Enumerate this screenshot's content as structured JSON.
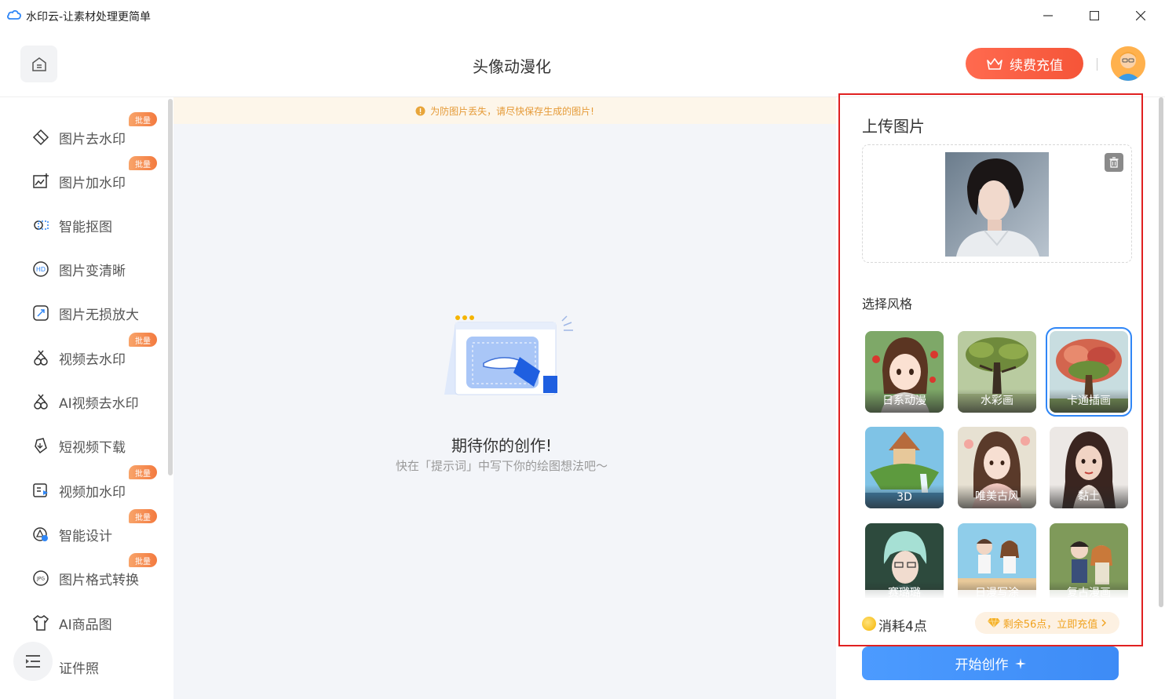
{
  "window": {
    "title": "水印云-让素材处理更简单"
  },
  "header": {
    "page_title": "头像动漫化",
    "renew_label": "续费充值"
  },
  "sidebar": {
    "batch_badge": "批量",
    "items": [
      {
        "label": "图片去水印",
        "icon": "eraser-icon",
        "batch": true
      },
      {
        "label": "图片加水印",
        "icon": "image-add-icon",
        "batch": true
      },
      {
        "label": "智能抠图",
        "icon": "cutout-icon",
        "batch": false
      },
      {
        "label": "图片变清晰",
        "icon": "hd-icon",
        "batch": false
      },
      {
        "label": "图片无损放大",
        "icon": "enlarge-icon",
        "batch": false
      },
      {
        "label": "视频去水印",
        "icon": "video-clean-icon",
        "batch": true
      },
      {
        "label": "AI视频去水印",
        "icon": "ai-video-icon",
        "batch": false
      },
      {
        "label": "短视频下载",
        "icon": "download-icon",
        "batch": false
      },
      {
        "label": "视频加水印",
        "icon": "video-add-icon",
        "batch": true
      },
      {
        "label": "智能设计",
        "icon": "design-icon",
        "batch": true
      },
      {
        "label": "图片格式转换",
        "icon": "jpg-convert-icon",
        "batch": true
      },
      {
        "label": "AI商品图",
        "icon": "tshirt-icon",
        "batch": false
      },
      {
        "label": "证件照",
        "icon": "id-photo-icon",
        "batch": false
      }
    ]
  },
  "main": {
    "notice": "为防图片丢失，请尽快保存生成的图片!",
    "empty_title": "期待你的创作!",
    "empty_subtitle": "快在「提示词」中写下你的绘图想法吧～"
  },
  "panel": {
    "upload_title": "上传图片",
    "style_title": "选择风格",
    "styles": [
      {
        "label": "日系动漫",
        "selected": false
      },
      {
        "label": "水彩画",
        "selected": false
      },
      {
        "label": "卡通插画",
        "selected": true
      },
      {
        "label": "3D",
        "selected": false
      },
      {
        "label": "唯美古风",
        "selected": false
      },
      {
        "label": "黏土",
        "selected": false
      },
      {
        "label": "赛璐璐",
        "selected": false
      },
      {
        "label": "日漫写涂",
        "selected": false
      },
      {
        "label": "复古漫画",
        "selected": false
      }
    ],
    "cost_text": "消耗4点",
    "remaining_text": "剩余56点，立即充值",
    "create_label": "开始创作"
  },
  "colors": {
    "accent_blue": "#3d8bf6",
    "renew_red": "#f55538",
    "badge_orange": "#f37a3f",
    "highlight_frame": "#e02020"
  }
}
